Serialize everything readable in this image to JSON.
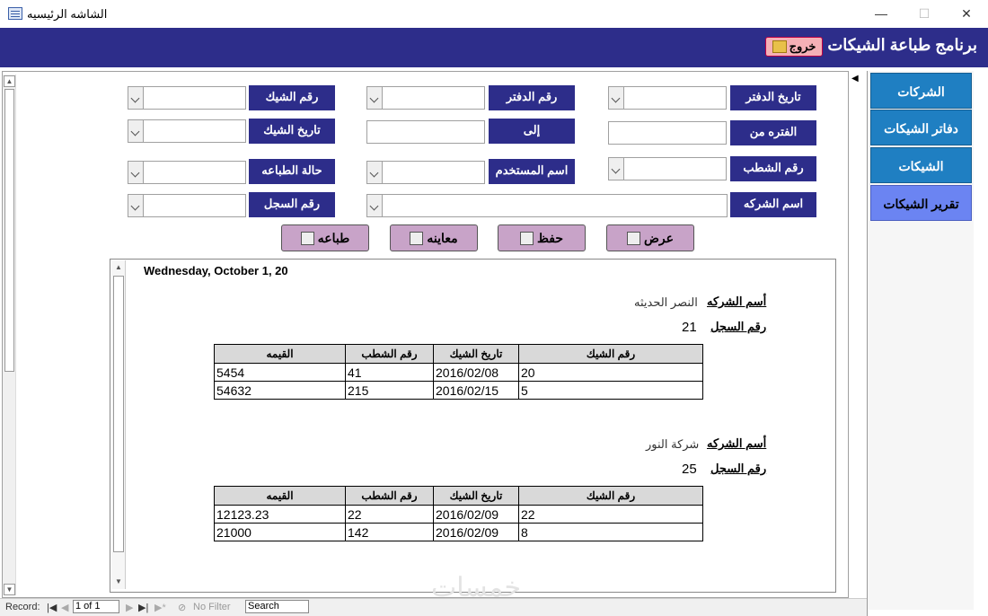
{
  "window": {
    "title": "الشاشه الرئيسيه",
    "minimize": "—",
    "maximize": "☐",
    "close": "✕"
  },
  "header": {
    "title": "برنامج طباعة الشيكات",
    "exit_label": "خروج"
  },
  "nav": {
    "items": [
      "الشركات",
      "دفاتر الشيكات",
      "الشيكات",
      "تقرير الشيكات"
    ],
    "active_index": 3
  },
  "filters": {
    "book_date": "تاريخ الدفتر",
    "book_no": "رقم الدفتر",
    "check_no": "رقم الشيك",
    "period_from": "الفتره من",
    "to": "إلى",
    "check_date": "تاريخ الشيك",
    "stub_no": "رقم الشطب",
    "user_name": "اسم المستخدم",
    "print_status": "حالة الطباعه",
    "company_name": "اسم الشركه",
    "record_no": "رقم السجل"
  },
  "actions": {
    "show": "عرض",
    "save": "حفظ",
    "preview": "معاينه",
    "print": "طباعه"
  },
  "report": {
    "date": "Wednesday, October 1, 20",
    "company_label": "أسم الشركه",
    "record_label": "رقم السجل",
    "columns": [
      "رقم الشيك",
      "تاريخ الشيك",
      "رقم الشطب",
      "القيمه"
    ],
    "groups": [
      {
        "company": "النصر الحديثه",
        "record": "21",
        "rows": [
          [
            "20",
            "2016/02/08",
            "41",
            "5454"
          ],
          [
            "5",
            "2016/02/15",
            "215",
            "54632"
          ]
        ]
      },
      {
        "company": "شركة النور",
        "record": "25",
        "rows": [
          [
            "22",
            "2016/02/09",
            "22",
            "12123.23"
          ],
          [
            "8",
            "2016/02/09",
            "142",
            "21000"
          ]
        ]
      }
    ]
  },
  "statusbar": {
    "record_label": "Record:",
    "record_value": "1 of 1",
    "no_filter": "No Filter",
    "search": "Search"
  },
  "watermark": "خمسات"
}
